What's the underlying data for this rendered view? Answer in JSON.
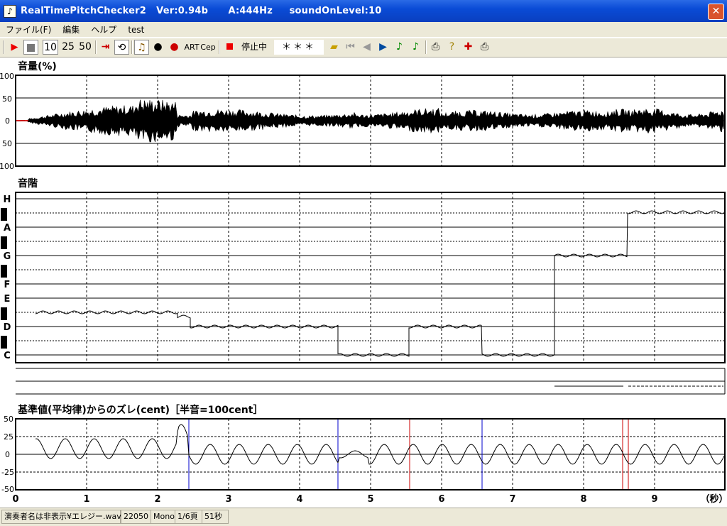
{
  "window": {
    "title": "RealTimePitchChecker2   Ver:0.94b      A:444Hz     soundOnLevel:10",
    "close_glyph": "✕"
  },
  "menu": [
    "ファイル(F)",
    "編集",
    "ヘルプ",
    "test"
  ],
  "toolbar": {
    "speed_buttons": [
      "10",
      "25",
      "50"
    ],
    "art_label": "ART",
    "cep_label": "Cep",
    "status_label": "停止中",
    "note_display": "＊＊＊"
  },
  "volume_panel": {
    "title": "音量(%)",
    "y_ticks": [
      "100",
      "50",
      "0",
      "50",
      "100"
    ]
  },
  "scale_panel": {
    "title": "音階",
    "note_labels": [
      "H",
      "A",
      "G",
      "F",
      "E",
      "D",
      "C"
    ]
  },
  "deviation_panel": {
    "title": "基準値(平均律)からのズレ(cent)［半音=100cent］",
    "y_ticks": [
      "50",
      "25",
      "0",
      "-25",
      "-50"
    ]
  },
  "x_axis": {
    "ticks": [
      "0",
      "1",
      "2",
      "3",
      "4",
      "5",
      "6",
      "7",
      "8",
      "9"
    ],
    "unit_label": "（秒）"
  },
  "status": {
    "file": "演奏者名は非表示¥エレジー.wav",
    "rate": "22050",
    "channels": "Mono",
    "page": "1/6頁",
    "duration": "51秒"
  }
}
